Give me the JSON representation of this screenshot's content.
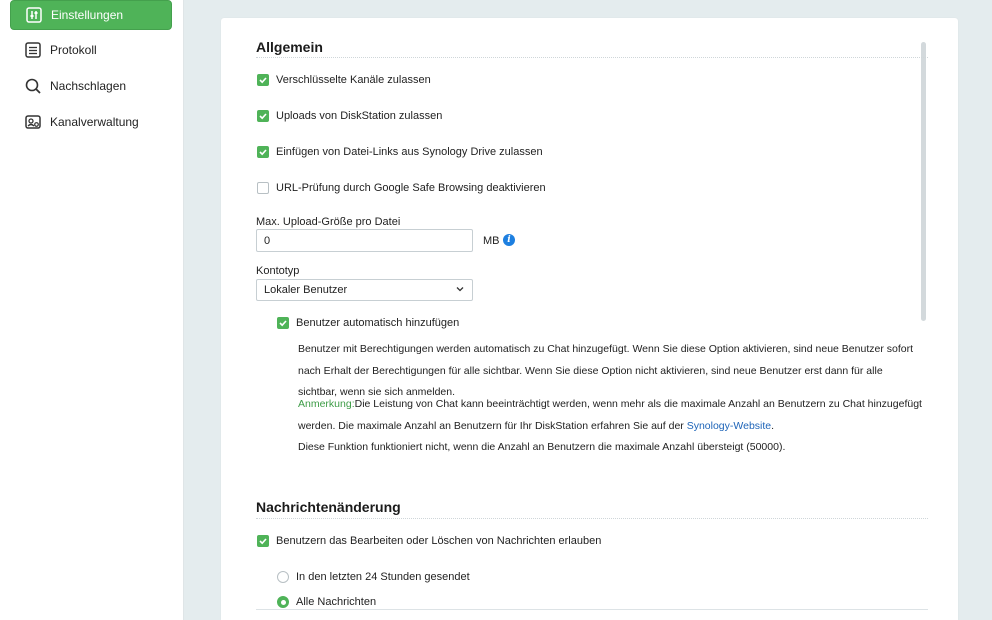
{
  "sidebar": {
    "items": [
      {
        "label": "Einstellungen",
        "icon": "settings-sliders-icon",
        "active": true
      },
      {
        "label": "Protokoll",
        "icon": "log-list-icon"
      },
      {
        "label": "Nachschlagen",
        "icon": "search-icon"
      },
      {
        "label": "Kanalverwaltung",
        "icon": "channel-management-icon"
      }
    ]
  },
  "general": {
    "title": "Allgemein",
    "checkboxes": [
      {
        "label": "Verschlüsselte Kanäle zulassen",
        "checked": true
      },
      {
        "label": "Uploads von DiskStation zulassen",
        "checked": true
      },
      {
        "label": "Einfügen von Datei-Links aus Synology Drive zulassen",
        "checked": true
      },
      {
        "label": "URL-Prüfung durch Google Safe Browsing deaktivieren",
        "checked": false
      }
    ],
    "upload_size": {
      "label": "Max. Upload-Größe pro Datei",
      "value": "0",
      "unit": "MB"
    },
    "account_type": {
      "label": "Kontotyp",
      "selected": "Lokaler Benutzer"
    },
    "auto_add": {
      "label": "Benutzer automatisch hinzufügen",
      "checked": true,
      "description": "Benutzer mit Berechtigungen werden automatisch zu Chat hinzugefügt. Wenn Sie diese Option aktivieren, sind neue Benutzer sofort nach Erhalt der Berechtigungen für alle sichtbar. Wenn Sie diese Option nicht aktivieren, sind neue Benutzer erst dann für alle sichtbar, wenn sie sich anmelden.",
      "note_label": "Anmerkung:",
      "note_text": "Die Leistung von Chat kann beeinträchtigt werden, wenn mehr als die maximale Anzahl an Benutzern zu Chat hinzugefügt werden. Die maximale Anzahl an Benutzern für Ihr DiskStation erfahren Sie auf der ",
      "note_link": "Synology-Website",
      "note_end": ".",
      "note_line3": "Diese Funktion funktioniert nicht, wenn die Anzahl an Benutzern die maximale Anzahl übersteigt (50000)."
    }
  },
  "message_edit": {
    "title": "Nachrichtenänderung",
    "allow": {
      "label": "Benutzern das Bearbeiten oder Löschen von Nachrichten erlauben",
      "checked": true
    },
    "radios": [
      {
        "label": "In den letzten 24 Stunden gesendet",
        "selected": false
      },
      {
        "label": "Alle Nachrichten",
        "selected": true
      }
    ]
  },
  "colors": {
    "accent": "#4fb358",
    "link": "#1d64b8",
    "info": "#1d7fe0"
  }
}
